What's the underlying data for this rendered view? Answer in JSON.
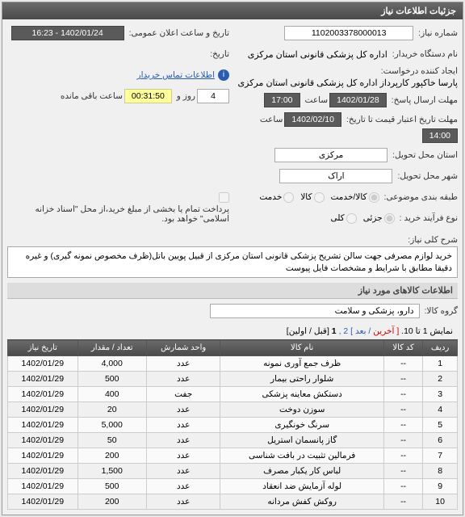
{
  "header": {
    "title": "جزئیات اطلاعات نیاز"
  },
  "labels": {
    "niaz_number": "شماره نیاز:",
    "buyer_org": "نام دستگاه خریدار:",
    "requester": "ایجاد کننده درخواست:",
    "reply_deadline": "مهلت ارسال پاسخ:",
    "valid_from": "مهلت تاریخ اعتبار قیمت تا تاریخ:",
    "delivery_province": "استان محل تحویل:",
    "delivery_city": "شهر محل تحویل:",
    "subject_category": "طبقه بندی موضوعی:",
    "purchase_type": "نوع فرآیند خرید :",
    "public_date": "تاریخ و ساعت اعلان عمومی:",
    "date_label": "تاریخ:",
    "time_label": "ساعت",
    "and_label": "روز و",
    "remaining": "ساعت باقی مانده",
    "contact_link": "اطلاعات تماس خریدار",
    "kala_khedmat": "کالا/خدمت",
    "kala": "کالا",
    "khedmat": "خدمت",
    "jozei": "جزئی",
    "koli": "کلی",
    "purchase_note": "پرداخت تمام یا بخشی از مبلغ خرید،از محل \"اسناد خزانه اسلامی\" خواهد بود.",
    "general_desc": "شرح کلی نیاز:",
    "section_kala": "اطلاعات کالاهای مورد نیاز",
    "kala_group": "گروه کالا:",
    "pager_prefix": "نمایش 1 تا 10.",
    "pager_last": "[ آخرین",
    "pager_next": "بعد ]",
    "pager_page": "2 ,",
    "pager_current": "1",
    "pager_first": "[قبل / اولین]"
  },
  "values": {
    "niaz_number": "1102003378000013",
    "buyer_org": "اداره کل پزشکی قانونی استان مرکزی",
    "requester": "پارسا خاکپور کارپرداز اداره کل پزشکی قانونی استان مرکزی",
    "reply_date": "1402/01/28",
    "reply_time": "17:00",
    "reply_days": "4",
    "reply_countdown": "00:31:50",
    "valid_date": "1402/02/10",
    "valid_time": "14:00",
    "province": "مرکزی",
    "city": "اراک",
    "public_datetime": "1402/01/24 - 16:23",
    "date_empty": "",
    "general_desc": "خرید لوازم مصرفی جهت سالن تشریح پزشکی قانونی استان مرکزی از قبیل پویین باتل(ظرف مخصوص نمونه گیری) و غیره  دقیقا مطابق با شرایط و مشخصات فایل پیوست",
    "kala_group": "دارو، پزشکی و سلامت"
  },
  "grid": {
    "headers": [
      "ردیف",
      "کد کالا",
      "نام کالا",
      "واحد شمارش",
      "تعداد / مقدار",
      "تاریخ نیاز"
    ],
    "rows": [
      [
        "1",
        "--",
        "ظرف جمع آوری نمونه",
        "عدد",
        "4,000",
        "1402/01/29"
      ],
      [
        "2",
        "--",
        "شلوار راحتی بیمار",
        "عدد",
        "500",
        "1402/01/29"
      ],
      [
        "3",
        "--",
        "دستکش معاینه پزشکی",
        "جفت",
        "400",
        "1402/01/29"
      ],
      [
        "4",
        "--",
        "سوزن دوخت",
        "عدد",
        "20",
        "1402/01/29"
      ],
      [
        "5",
        "--",
        "سرنگ خونگیری",
        "عدد",
        "5,000",
        "1402/01/29"
      ],
      [
        "6",
        "--",
        "گاز پانسمان استریل",
        "عدد",
        "50",
        "1402/01/29"
      ],
      [
        "7",
        "--",
        "فرمالین تثبیت در بافت شناسی",
        "عدد",
        "200",
        "1402/01/29"
      ],
      [
        "8",
        "--",
        "لباس کار یکبار مصرف",
        "عدد",
        "1,500",
        "1402/01/29"
      ],
      [
        "9",
        "--",
        "لوله آزمایش ضد انعقاد",
        "عدد",
        "500",
        "1402/01/29"
      ],
      [
        "10",
        "--",
        "روکش کفش مردانه",
        "عدد",
        "200",
        "1402/01/29"
      ]
    ]
  }
}
